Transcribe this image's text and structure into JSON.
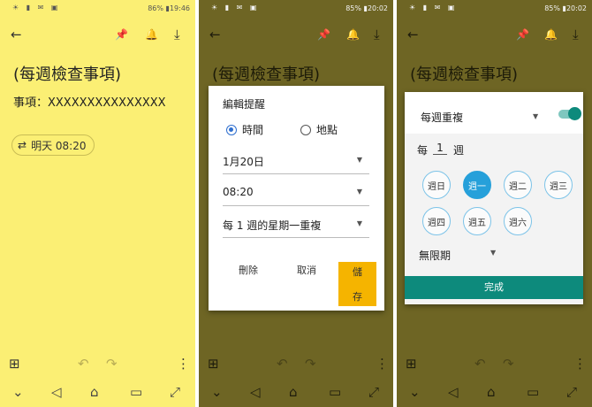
{
  "status_bar": {
    "left_icons": "☀ ▮ ✉ ▣",
    "panel1_right": "86% ▮19:46",
    "panel2_right": "85% ▮20:02",
    "panel3_right": "85% ▮20:02"
  },
  "toolbar": {
    "back_glyph": "←",
    "pin_glyph": "📌",
    "reminder_glyph": "🔔",
    "archive_glyph": "⤓"
  },
  "note": {
    "title": "(每週檢查事項)",
    "item_line": "事項：XXXXXXXXXXXXXXX",
    "reminder_chip": "明天 08:20",
    "reminder_chip_icon": "⇄"
  },
  "bottom_bar": {
    "add_glyph": "⊞",
    "undo_glyph": "↶",
    "redo_glyph": "↷",
    "more_glyph": "⋮"
  },
  "nav_bar": {
    "down_glyph": "⌄",
    "back_glyph": "◁",
    "home_glyph": "⌂",
    "recent_glyph": "▭",
    "screen_glyph": "⤢"
  },
  "edit_reminder_dialog": {
    "title": "編輯提醒",
    "option_time": "時間",
    "option_place": "地點",
    "date_value": "1月20日",
    "time_value": "08:20",
    "repeat_value": "每 1 週的星期一重複",
    "delete_label": "刪除",
    "cancel_label": "取消",
    "save_label_1": "儲",
    "save_label_2": "存"
  },
  "repeat_panel": {
    "mode": "每週重複",
    "every_label": "每",
    "every_value": "1",
    "unit_label": "週",
    "days": [
      "週日",
      "週一",
      "週二",
      "週三",
      "週四",
      "週五",
      "週六"
    ],
    "selected_day": "週一",
    "end_value": "無限期",
    "done_label": "完成"
  },
  "colors": {
    "note_bg": "#fbef74",
    "dim_bg": "#6e6524",
    "accent_blue": "#26a0da",
    "save_yellow": "#f5b400",
    "teal": "#0d8a7c"
  }
}
